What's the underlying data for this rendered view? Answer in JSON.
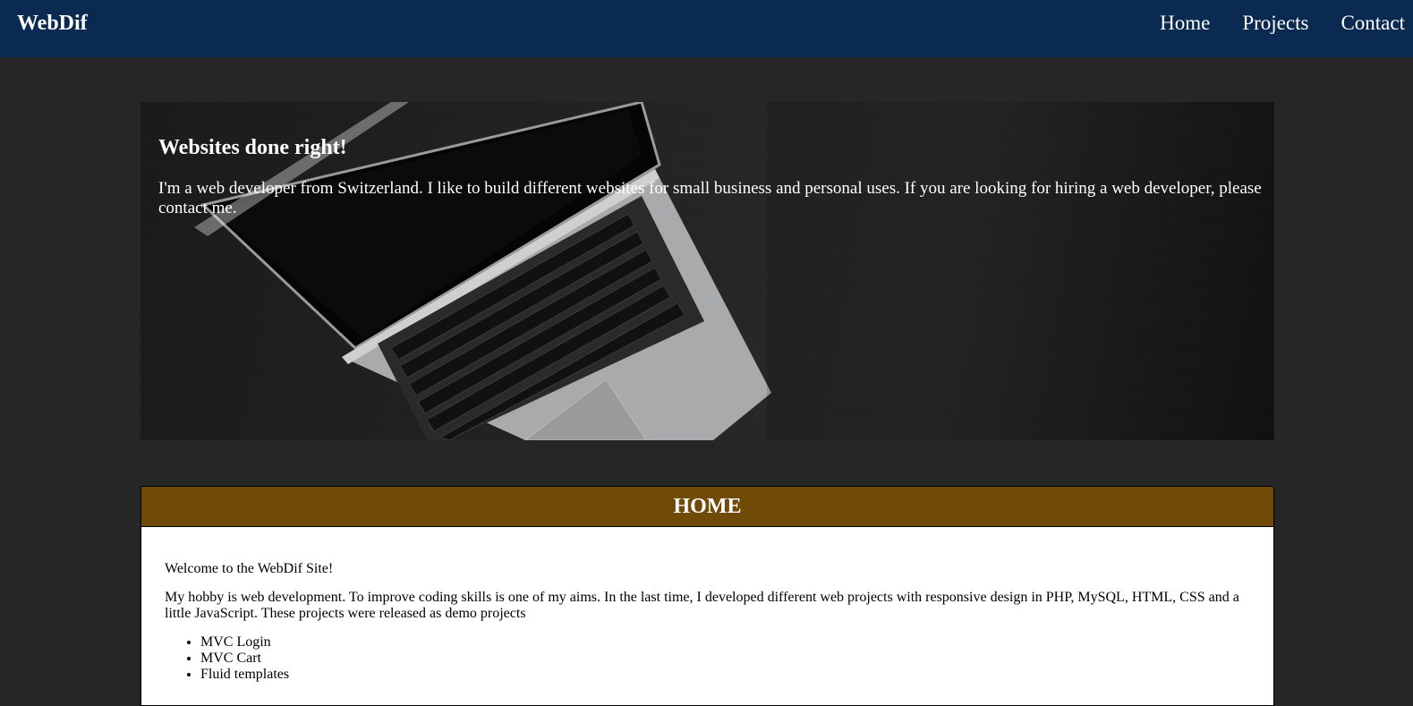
{
  "navbar": {
    "brand": "WebDif",
    "links": [
      "Home",
      "Projects",
      "Contact"
    ]
  },
  "hero": {
    "title": "Websites done right!",
    "text": "I'm a web developer from Switzerland. I like to build different websites for small business and personal uses. If you are looking for hiring a web developer, please contact me."
  },
  "section": {
    "title": "HOME",
    "welcome": "Welcome to the WebDif Site!",
    "intro": "My hobby is web development. To improve coding skills is one of my aims. In the last time, I developed different web projects with responsive design in PHP, MySQL, HTML, CSS and a little JavaScript. These projects were released as demo projects",
    "projects": [
      "MVC Login",
      "MVC Cart",
      "Fluid templates"
    ]
  },
  "colors": {
    "navbar": "#0a2a52",
    "background": "#262626",
    "section_header": "#704b08"
  }
}
